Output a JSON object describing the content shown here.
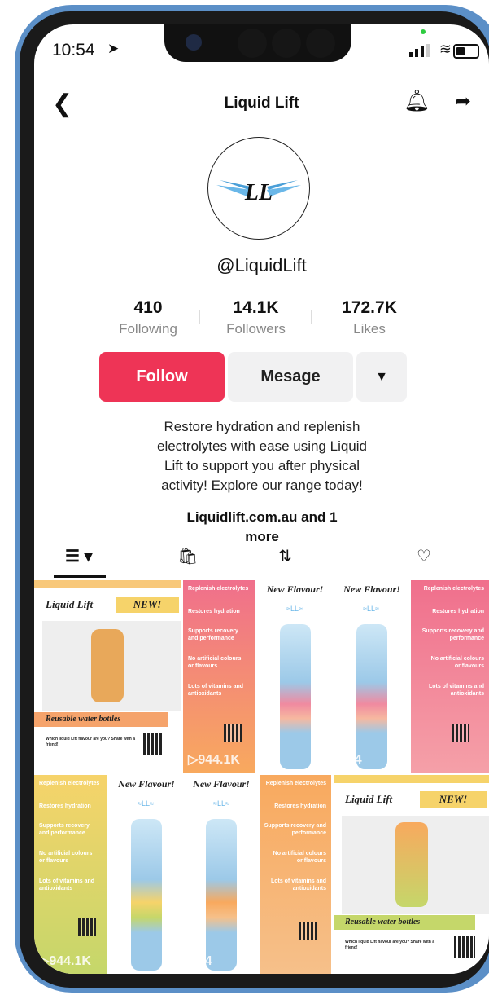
{
  "status": {
    "time": "10:54"
  },
  "nav": {
    "title": "Liquid Lift"
  },
  "profile": {
    "logo_text": "LL",
    "username": "@LiquidLift",
    "stats": [
      {
        "value": "410",
        "label": "Following"
      },
      {
        "value": "14.1K",
        "label": "Followers"
      },
      {
        "value": "172.7K",
        "label": "Likes"
      }
    ],
    "follow_label": "Follow",
    "message_label": "Mesage",
    "bio_lines": [
      "Restore hydration and replenish",
      "electrolytes with ease using Liquid",
      "Lift to support you after physical",
      "activity! Explore our range today!"
    ],
    "link_lines": [
      "Liquidlift.com.au and 1",
      "more"
    ]
  },
  "grid": {
    "tiles": [
      {
        "brand": "Liquid Lift",
        "badge": "NEW!",
        "caption": "Reusable water bottles",
        "footer": "Which liquid Lift flavour are you? Share with a friend!"
      },
      {
        "lines": [
          "Replenish electrolytes",
          "Restores hydration",
          "Supports recovery and performance",
          "No artificial colours or flavours",
          "Lots of vitamins and antioxidants"
        ],
        "views": "944.1K"
      },
      {
        "heading": "New Flavour!"
      },
      {
        "heading": "New Flavour!",
        "views": "944"
      },
      {
        "lines": [
          "Replenish electrolytes",
          "Restores hydration",
          "Supports recovery and performance",
          "No artificial colours or flavours",
          "Lots of vitamins and antioxidants"
        ]
      },
      {
        "lines": [
          "Replenish electrolytes",
          "Restores hydration",
          "Supports recovery and performance",
          "No artificial colours or flavours",
          "Lots of vitamins and antioxidants"
        ],
        "views": "944.1K"
      },
      {
        "heading": "New Flavour!"
      },
      {
        "heading": "New Flavour!",
        "views": "944"
      },
      {
        "lines": [
          "Replenish electrolytes",
          "Restores hydration",
          "Supports recovery and performance",
          "No artificial colours or flavours",
          "Lots of vitamins and antioxidants"
        ]
      },
      {
        "brand": "Liquid Lift",
        "badge": "NEW!",
        "caption": "Reusable water bottles",
        "footer": "Which liquid Lift flavour are you? Share with a friend!"
      }
    ]
  },
  "colors": {
    "follow": "#ee3456",
    "pink": "#f06f8c",
    "orange": "#f8a95e",
    "yellow": "#f6d36a",
    "green": "#c5d76a"
  }
}
